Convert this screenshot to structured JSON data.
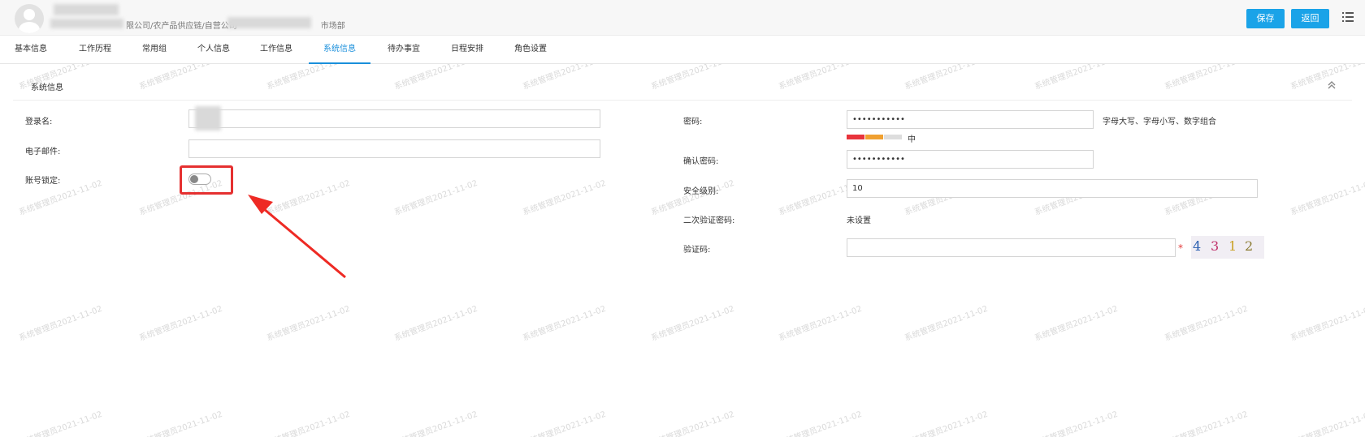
{
  "header": {
    "org_path_suffix": "限公司/农产品供应链/自营公司",
    "org_path_tail": "市场部",
    "save_label": "保存",
    "back_label": "返回"
  },
  "tabs": [
    {
      "label": "基本信息"
    },
    {
      "label": "工作历程"
    },
    {
      "label": "常用组"
    },
    {
      "label": "个人信息"
    },
    {
      "label": "工作信息"
    },
    {
      "label": "系统信息"
    },
    {
      "label": "待办事宜"
    },
    {
      "label": "日程安排"
    },
    {
      "label": "角色设置"
    }
  ],
  "active_tab": "系统信息",
  "section": {
    "title": "系统信息"
  },
  "form_left": {
    "login_name_label": "登录名:",
    "email_label": "电子邮件:",
    "account_lock_label": "账号锁定:",
    "account_lock_on": false
  },
  "form_right": {
    "password_label": "密码:",
    "password_value": "•••••••••••",
    "password_hint": "字母大写、字母小写、数字组合",
    "strength_label": "中",
    "confirm_password_label": "确认密码:",
    "confirm_password_value": "•••••••••••",
    "security_level_label": "安全级别:",
    "security_level_value": "10",
    "second_verify_label": "二次验证密码:",
    "second_verify_value": "未设置",
    "captcha_label": "验证码:",
    "captcha_required": "*",
    "captcha_digits": [
      "4",
      "3",
      "1",
      "2"
    ]
  },
  "watermark": "系统管理员2021-11-02",
  "colors": {
    "primary": "#1aa3e8",
    "tab_active": "#1a8fdb",
    "highlight": "#e53030",
    "strength_weak": "#e8343c",
    "strength_medium": "#f0a030",
    "strength_empty": "#dddddd"
  }
}
